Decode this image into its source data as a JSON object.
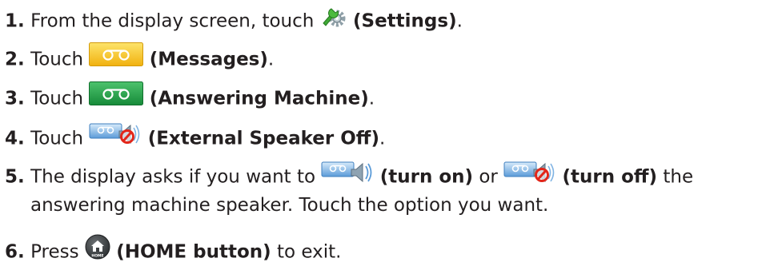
{
  "steps": [
    {
      "num": "1.",
      "pre": "From the display screen, touch",
      "icon": "settings-icon",
      "label": "(Settings)",
      "post": "."
    },
    {
      "num": "2.",
      "pre": "Touch",
      "icon": "messages-icon",
      "label": "(Messages)",
      "post": "."
    },
    {
      "num": "3.",
      "pre": "Touch",
      "icon": "answering-machine-icon",
      "label": "(Answering Machine)",
      "post": "."
    },
    {
      "num": "4.",
      "pre": "Touch",
      "icon": "external-speaker-off-icon",
      "label": "(External Speaker Off)",
      "post": "."
    },
    {
      "num": "5.",
      "pre": "The display asks if you want to",
      "icon_a": "speaker-on-icon",
      "label_a": "(turn on)",
      "mid": "or",
      "icon_b": "speaker-off-icon",
      "label_b": "(turn off)",
      "post": "the",
      "line2": "answering machine speaker. Touch the option you want."
    },
    {
      "num": "6.",
      "pre": "Press",
      "icon": "home-button-icon",
      "label": "(HOME button)",
      "post": "to exit.",
      "icon_text": "HOME"
    }
  ],
  "colors": {
    "text": "#231f20",
    "messages_yellow": "#f6c21a",
    "answering_green": "#23a047",
    "tape_blue": "#5b9bd8",
    "no_red": "#e2261a",
    "home_dark": "#3b3e40"
  }
}
